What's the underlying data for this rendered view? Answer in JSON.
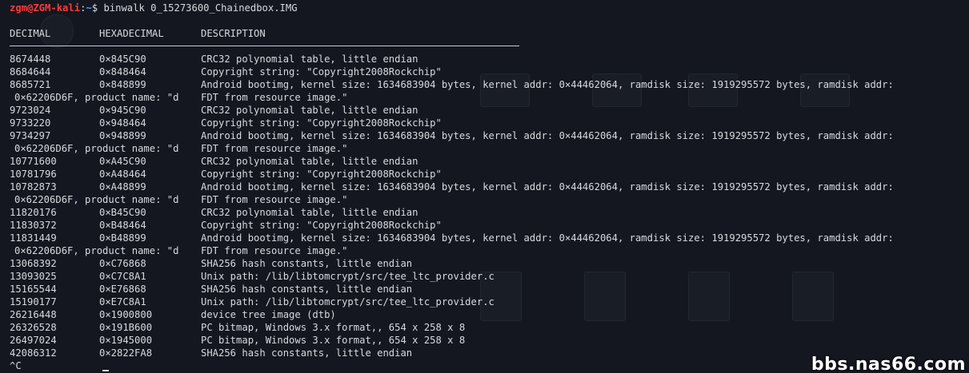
{
  "prompt": {
    "user_host": "zgm@ZGM-kali",
    "path": "~",
    "symbol": "$",
    "command": "binwalk 0_15273600_Chainedbox.IMG"
  },
  "headers": [
    "DECIMAL",
    "HEXADECIMAL",
    "DESCRIPTION"
  ],
  "rows": [
    {
      "dec": "8674448",
      "hex": "0×845C90",
      "desc": "CRC32 polynomial table, little endian"
    },
    {
      "dec": "8684644",
      "hex": "0×848464",
      "desc": "Copyright string: \"Copyright2008Rockchip\""
    },
    {
      "dec": "8685721",
      "hex": "0×848899",
      "desc": "Android bootimg, kernel size: 1634683904 bytes, kernel addr: 0×44462064, ramdisk size: 1919295572 bytes, ramdisk addr:"
    },
    {
      "cont": true,
      "left": "0×62206D6F, product name: \"d",
      "right": "FDT from resource image.\""
    },
    {
      "dec": "9723024",
      "hex": "0×945C90",
      "desc": "CRC32 polynomial table, little endian"
    },
    {
      "dec": "9733220",
      "hex": "0×948464",
      "desc": "Copyright string: \"Copyright2008Rockchip\""
    },
    {
      "dec": "9734297",
      "hex": "0×948899",
      "desc": "Android bootimg, kernel size: 1634683904 bytes, kernel addr: 0×44462064, ramdisk size: 1919295572 bytes, ramdisk addr:"
    },
    {
      "cont": true,
      "left": "0×62206D6F, product name: \"d",
      "right": "FDT from resource image.\""
    },
    {
      "dec": "10771600",
      "hex": "0×A45C90",
      "desc": "CRC32 polynomial table, little endian"
    },
    {
      "dec": "10781796",
      "hex": "0×A48464",
      "desc": "Copyright string: \"Copyright2008Rockchip\""
    },
    {
      "dec": "10782873",
      "hex": "0×A48899",
      "desc": "Android bootimg, kernel size: 1634683904 bytes, kernel addr: 0×44462064, ramdisk size: 1919295572 bytes, ramdisk addr:"
    },
    {
      "cont": true,
      "left": "0×62206D6F, product name: \"d",
      "right": "FDT from resource image.\""
    },
    {
      "dec": "11820176",
      "hex": "0×B45C90",
      "desc": "CRC32 polynomial table, little endian"
    },
    {
      "dec": "11830372",
      "hex": "0×B48464",
      "desc": "Copyright string: \"Copyright2008Rockchip\""
    },
    {
      "dec": "11831449",
      "hex": "0×B48899",
      "desc": "Android bootimg, kernel size: 1634683904 bytes, kernel addr: 0×44462064, ramdisk size: 1919295572 bytes, ramdisk addr:"
    },
    {
      "cont": true,
      "left": "0×62206D6F, product name: \"d",
      "right": "FDT from resource image.\""
    },
    {
      "dec": "13068392",
      "hex": "0×C76868",
      "desc": "SHA256 hash constants, little endian"
    },
    {
      "dec": "13093025",
      "hex": "0×C7C8A1",
      "desc": "Unix path: /lib/libtomcrypt/src/tee_ltc_provider.c"
    },
    {
      "dec": "15165544",
      "hex": "0×E76868",
      "desc": "SHA256 hash constants, little endian"
    },
    {
      "dec": "15190177",
      "hex": "0×E7C8A1",
      "desc": "Unix path: /lib/libtomcrypt/src/tee_ltc_provider.c"
    },
    {
      "dec": "26216448",
      "hex": "0×1900800",
      "desc": "device tree image (dtb)"
    },
    {
      "dec": "26326528",
      "hex": "0×191B600",
      "desc": "PC bitmap, Windows 3.x format,, 654 x 258 x 8"
    },
    {
      "dec": "26497024",
      "hex": "0×1945000",
      "desc": "PC bitmap, Windows 3.x format,, 654 x 258 x 8"
    },
    {
      "dec": "42086312",
      "hex": "0×2822FA8",
      "desc": "SHA256 hash constants, little endian"
    }
  ],
  "interrupt": "^C",
  "watermark": "bbs.nas66.com",
  "colors": {
    "background": "#141720",
    "text": "#d7d9de",
    "user_host": "#ff3b3b",
    "path": "#4fa3ff"
  }
}
